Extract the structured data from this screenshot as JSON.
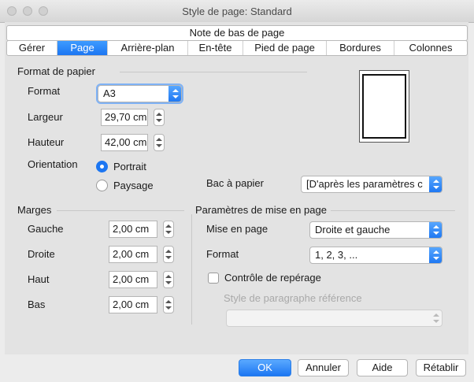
{
  "window": {
    "title": "Style de page: Standard"
  },
  "top_tab": "Note de bas de page",
  "tabs": [
    {
      "label": "Gérer",
      "active": false
    },
    {
      "label": "Page",
      "active": true
    },
    {
      "label": "Arrière-plan",
      "active": false
    },
    {
      "label": "En-tête",
      "active": false
    },
    {
      "label": "Pied de page",
      "active": false
    },
    {
      "label": "Bordures",
      "active": false
    },
    {
      "label": "Colonnes",
      "active": false
    }
  ],
  "paper_format": {
    "section_title": "Format de papier",
    "format_label": "Format",
    "format_value": "A3",
    "width_label": "Largeur",
    "width_value": "29,70 cm",
    "height_label": "Hauteur",
    "height_value": "42,00 cm",
    "orientation_label": "Orientation",
    "portrait_label": "Portrait",
    "landscape_label": "Paysage",
    "tray_label": "Bac à papier",
    "tray_value": "[D'après les paramètres c"
  },
  "margins": {
    "section_title": "Marges",
    "left_label": "Gauche",
    "left_value": "2,00 cm",
    "right_label": "Droite",
    "right_value": "2,00 cm",
    "top_label": "Haut",
    "top_value": "2,00 cm",
    "bottom_label": "Bas",
    "bottom_value": "2,00 cm"
  },
  "layout_settings": {
    "section_title": "Paramètres de mise en page",
    "page_layout_label": "Mise en page",
    "page_layout_value": "Droite et gauche",
    "format_label": "Format",
    "format_value": "1, 2, 3, ...",
    "register_label": "Contrôle de repérage",
    "reference_style_label": "Style de paragraphe référence",
    "reference_style_value": ""
  },
  "buttons": {
    "ok": "OK",
    "cancel": "Annuler",
    "help": "Aide",
    "reset": "Rétablir"
  }
}
